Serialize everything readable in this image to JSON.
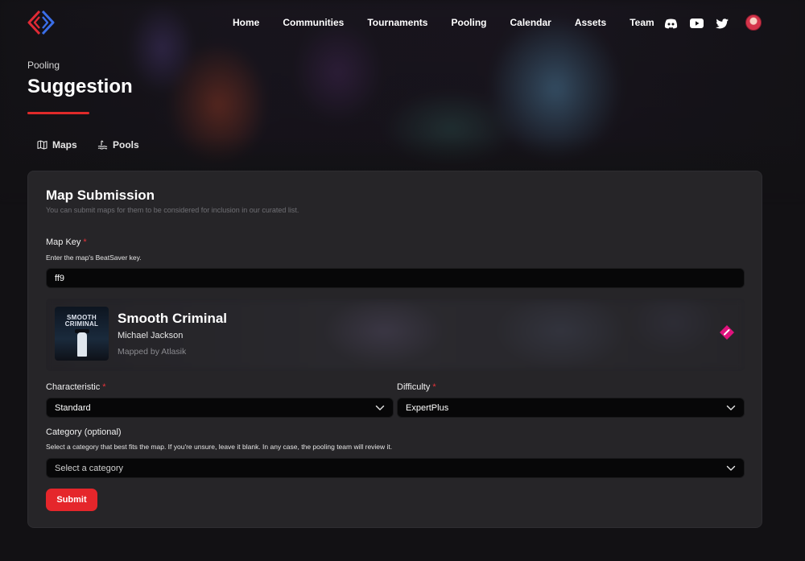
{
  "nav": {
    "links": [
      "Home",
      "Communities",
      "Tournaments",
      "Pooling",
      "Calendar",
      "Assets",
      "Team"
    ],
    "social_icons": [
      "discord-icon",
      "youtube-icon",
      "twitter-icon"
    ]
  },
  "header": {
    "breadcrumb": "Pooling",
    "title": "Suggestion"
  },
  "tabs": [
    {
      "label": "Maps",
      "icon": "map-icon"
    },
    {
      "label": "Pools",
      "icon": "pool-icon"
    }
  ],
  "form": {
    "title": "Map Submission",
    "subtitle": "You can submit maps for them to be considered for inclusion in our curated list.",
    "map_key": {
      "label": "Map Key",
      "required": "*",
      "hint": "Enter the map's BeatSaver key.",
      "value": "ff9"
    },
    "map_preview": {
      "cover_text": "SMOOTH CRIMINAL",
      "title": "Smooth Criminal",
      "artist": "Michael Jackson",
      "mapper": "Mapped by Atlasik",
      "icon": "beatsaver-icon"
    },
    "characteristic": {
      "label": "Characteristic",
      "required": "*",
      "value": "Standard"
    },
    "difficulty": {
      "label": "Difficulty",
      "required": "*",
      "value": "ExpertPlus"
    },
    "category": {
      "label": "Category (optional)",
      "hint": "Select a category that best fits the map. If you're unsure, leave it blank. In any case, the pooling team will review it.",
      "placeholder": "Select a category"
    },
    "submit_label": "Submit"
  },
  "colors": {
    "accent": "#e5262b",
    "card_bg": "#262528",
    "page_bg": "#121114",
    "beatsaver": "#e0127d"
  }
}
